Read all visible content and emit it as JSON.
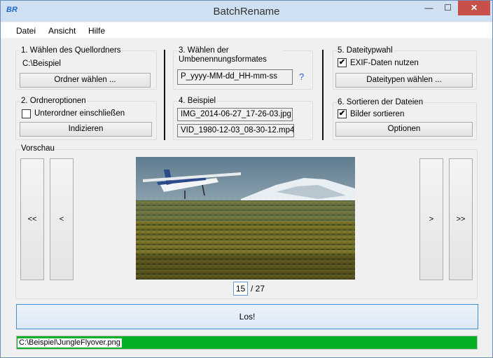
{
  "window": {
    "title": "BatchRename",
    "icon_text": "BR"
  },
  "titlebar_buttons": {
    "minimize": "—",
    "maximize": "☐",
    "close": "✕"
  },
  "menu": [
    "Datei",
    "Ansicht",
    "Hilfe"
  ],
  "step1": {
    "label": "1. Wählen des Quellordners",
    "path": "C:\\Beispiel",
    "button": "Ordner wählen ..."
  },
  "step2": {
    "label": "2. Ordneroptionen",
    "checkbox_label": "Unterordner einschließen",
    "checkbox_checked": false,
    "button": "Indizieren"
  },
  "step3": {
    "label": "3. Wählen der Umbenennungsformates",
    "format": "P_yyyy-MM-dd_HH-mm-ss",
    "help": "?"
  },
  "step4": {
    "label": "4. Beispiel",
    "examples": [
      "IMG_2014-06-27_17-26-03.jpg",
      "VID_1980-12-03_08-30-12.mp4"
    ]
  },
  "step5": {
    "label": "5. Dateitypwahl",
    "checkbox_label": "EXIF-Daten nutzen",
    "checkbox_checked": true,
    "button": "Dateitypen wählen ..."
  },
  "step6": {
    "label": "6. Sortieren der Dateien",
    "checkbox_label": "Bilder sortieren",
    "checkbox_checked": true,
    "button": "Optionen"
  },
  "preview": {
    "label": "Vorschau",
    "first": "<<",
    "prev": "<",
    "next": ">",
    "last": ">>",
    "current_page": "15",
    "total": "/ 27"
  },
  "go_button": "Los!",
  "status": {
    "text": "C:\\Beispiel\\JungleFlyover.png",
    "progress": 1.0,
    "color": "#06b025"
  },
  "checkmark": "✔"
}
